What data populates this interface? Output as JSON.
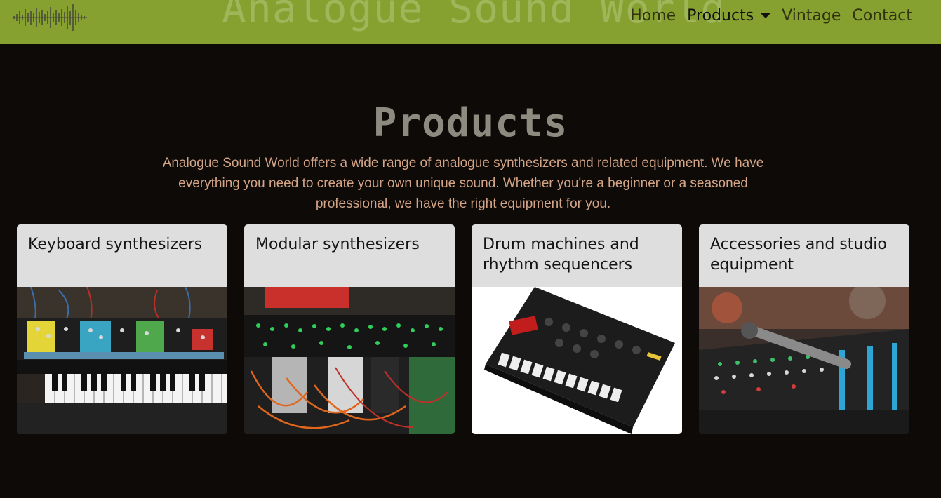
{
  "header": {
    "brand": "Analogue Sound World",
    "nav": [
      {
        "label": "Home"
      },
      {
        "label": "Products"
      },
      {
        "label": "Vintage"
      },
      {
        "label": "Contact"
      }
    ]
  },
  "main": {
    "title": "Products",
    "intro": "Analogue Sound World offers a wide range of analogue synthesizers and related equipment. We have everything you need to create your own unique sound. Whether you're a beginner or a seasoned professional, we have the right equipment for you.",
    "cards": [
      {
        "title": "Keyboard synthesizers",
        "image": "keyboard-synth-photo"
      },
      {
        "title": "Modular synthesizers",
        "image": "modular-synth-photo"
      },
      {
        "title": "Drum machines and rhythm sequencers",
        "image": "drum-machine-photo"
      },
      {
        "title": "Accessories and studio equipment",
        "image": "mixing-console-photo"
      }
    ]
  },
  "colors": {
    "header_bg": "#86a130",
    "page_bg": "#0d0a07",
    "title": "#8c8b80",
    "intro_text": "#d4a487",
    "card_header_bg": "#dedede"
  }
}
